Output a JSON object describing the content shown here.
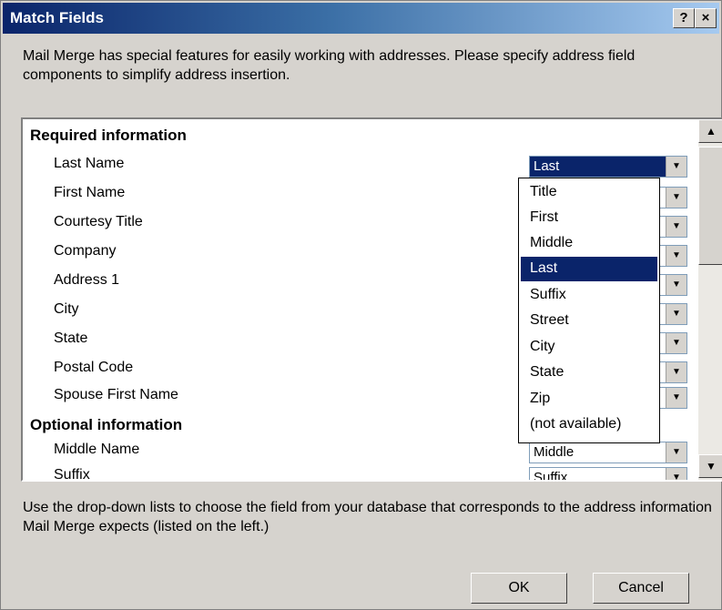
{
  "window": {
    "title": "Match Fields",
    "help_label": "?",
    "close_label": "×"
  },
  "intro_text": "Mail Merge has special features for easily working with addresses.  Please specify address field components to simplify address insertion.",
  "sections": [
    {
      "label": "Required information",
      "fields": [
        {
          "label": "Last Name",
          "value": "Last"
        },
        {
          "label": "First Name",
          "value": ""
        },
        {
          "label": "Courtesy Title",
          "value": ""
        },
        {
          "label": "Company",
          "value": ""
        },
        {
          "label": "Address 1",
          "value": ""
        },
        {
          "label": "City",
          "value": ""
        },
        {
          "label": "State",
          "value": ""
        },
        {
          "label": "Postal Code",
          "value": ""
        },
        {
          "label": "Spouse First Name",
          "value": ""
        }
      ]
    },
    {
      "label": "Optional information",
      "fields": [
        {
          "label": "Middle Name",
          "value": "Middle"
        },
        {
          "label": "Suffix",
          "value": "Suffix"
        }
      ]
    }
  ],
  "dropdown": {
    "selected": "Last",
    "options": [
      "Title",
      "First",
      "Middle",
      "Last",
      "Suffix",
      "Street",
      "City",
      "State",
      "Zip",
      "(not available)"
    ]
  },
  "footer_text": "Use the drop-down lists to choose the field from your database that corresponds to the address information Mail Merge expects (listed on the left.)",
  "buttons": {
    "ok_label": "OK",
    "cancel_label": "Cancel"
  },
  "icons": {
    "scroll_up": "scroll-up-arrow-icon",
    "scroll_down": "scroll-down-arrow-icon",
    "combo_arrow": "chevron-down-icon"
  },
  "colors": {
    "title_start": "#0a246a",
    "title_end": "#a6caf0",
    "selection": "#0a246a",
    "face": "#d6d3ce"
  }
}
